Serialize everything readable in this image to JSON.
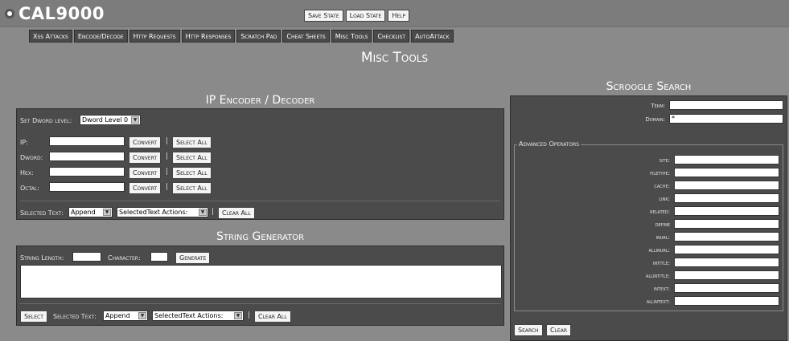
{
  "app": {
    "title": "CAL9000"
  },
  "header_buttons": [
    "Save State",
    "Load State",
    "Help"
  ],
  "tabs": [
    "Xss Attacks",
    "Encode/Decode",
    "Http Requests",
    "Http Responses",
    "Scratch Pad",
    "Cheat Sheets",
    "Misc Tools",
    "Checklist",
    "AutoAttack"
  ],
  "page_title": "Misc Tools",
  "ip": {
    "title": "IP Encoder / Decoder",
    "dword_level_label": "Set Dword level:",
    "dword_level_value": "Dword Level 0",
    "rows": [
      {
        "label": "IP:",
        "value": ""
      },
      {
        "label": "Dword:",
        "value": ""
      },
      {
        "label": "Hex:",
        "value": ""
      },
      {
        "label": "Octal:",
        "value": ""
      }
    ],
    "convert_label": "Convert",
    "select_all_label": "Select All",
    "separator": "|",
    "selected_text_label": "Selected Text:",
    "append_value": "Append",
    "actions_value": "SelectedText Actions:",
    "clear_all_label": "Clear All"
  },
  "string_gen": {
    "title": "String Generator",
    "length_label": "String Length:",
    "length_value": "",
    "char_label": "Character:",
    "char_value": "",
    "generate_label": "Generate",
    "select_label": "Select",
    "selected_text_label": "Selected Text:",
    "append_value": "Append",
    "actions_value": "SelectedText Actions:",
    "separator": "|",
    "clear_all_label": "Clear All"
  },
  "scroogle": {
    "title": "Scroogle Search",
    "term_label": "Term:",
    "term_value": "",
    "domain_label": "Domain:",
    "domain_value": "*",
    "advanced_legend": "Advanced Operators",
    "operators": [
      "site:",
      "filetype:",
      "cache:",
      "link:",
      "related:",
      "define",
      "inurl:",
      "allinurl:",
      "intitle:",
      "allintitle:",
      "intext:",
      "allintext:"
    ],
    "search_label": "Search",
    "clear_label": "Clear"
  }
}
